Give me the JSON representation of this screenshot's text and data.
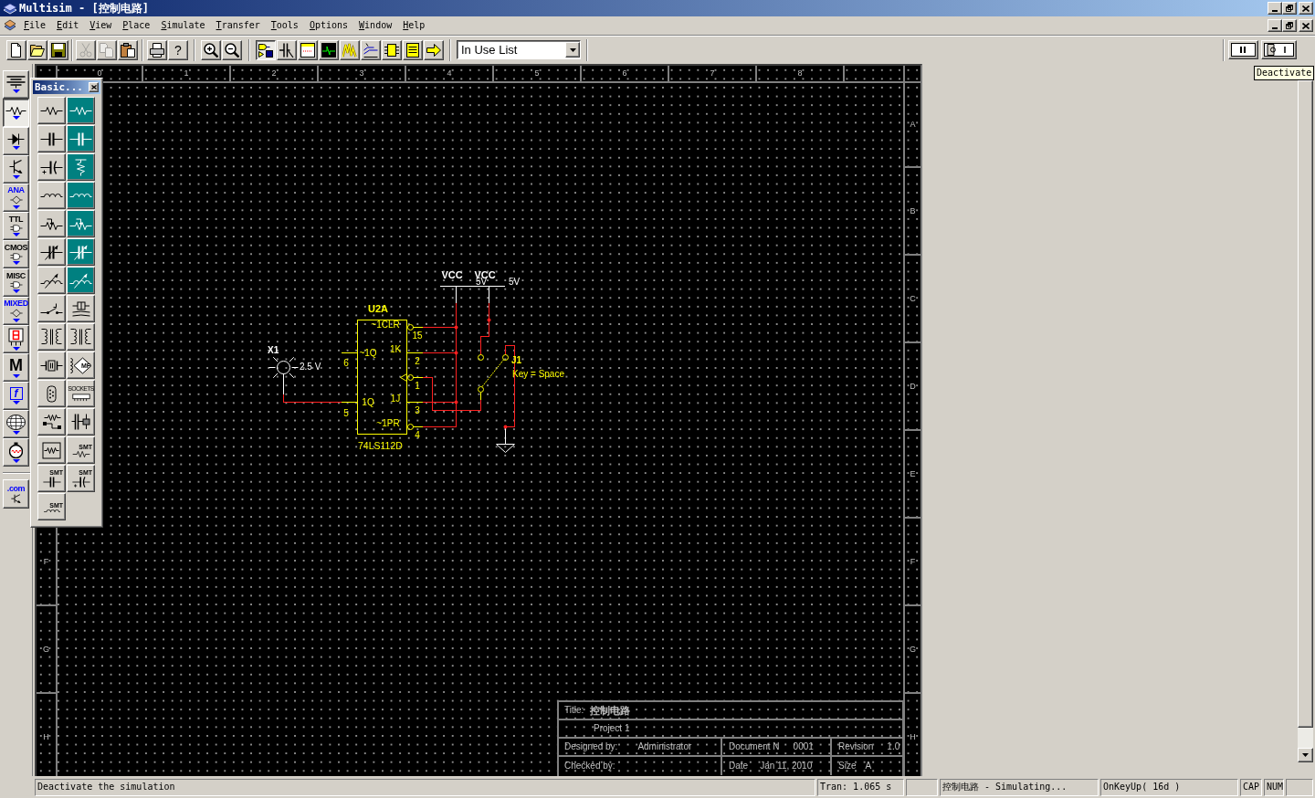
{
  "window": {
    "title": "Multisim - [控制电路]"
  },
  "menu": [
    "File",
    "Edit",
    "View",
    "Place",
    "Simulate",
    "Transfer",
    "Tools",
    "Options",
    "Window",
    "Help"
  ],
  "toolbar": {
    "buttons": [
      {
        "disabled": false,
        "pressed": false
      },
      {
        "disabled": false,
        "pressed": false
      },
      {
        "disabled": false,
        "pressed": false
      },
      {
        "disabled": true,
        "pressed": false
      },
      {
        "disabled": true,
        "pressed": false
      },
      {
        "disabled": false,
        "pressed": false
      },
      {
        "disabled": false,
        "pressed": false
      },
      {
        "label": "?",
        "disabled": false,
        "pressed": false
      },
      {
        "disabled": false,
        "pressed": false
      },
      {
        "disabled": false,
        "pressed": false
      },
      {
        "disabled": false,
        "pressed": true
      },
      {
        "disabled": false,
        "pressed": false
      },
      {
        "disabled": false,
        "pressed": false
      },
      {
        "disabled": false,
        "pressed": false
      },
      {
        "disabled": false,
        "pressed": false
      },
      {
        "disabled": false,
        "pressed": false
      },
      {
        "disabled": false,
        "pressed": false
      },
      {
        "disabled": false,
        "pressed": false
      },
      {
        "disabled": false,
        "pressed": false
      }
    ],
    "list": {
      "value": "In Use List"
    }
  },
  "simulation": {
    "running": true,
    "paused": false
  },
  "tooltip": {
    "text": "Deactivate"
  },
  "component_bins": [
    {
      "selected": false
    },
    {
      "selected": true
    },
    {
      "selected": false
    },
    {
      "selected": false
    },
    {
      "label": "ANA",
      "color": "#0000ff",
      "selected": false
    },
    {
      "label": "TTL",
      "color": "#000000",
      "selected": false
    },
    {
      "label": "CMOS",
      "color": "#000000",
      "selected": false
    },
    {
      "label": "MISC",
      "color": "#000000",
      "selected": false
    },
    {
      "label": "MIXED",
      "color": "#0000ff",
      "selected": false
    },
    {
      "selected": false
    },
    {
      "label": "M",
      "color": "#000000",
      "selected": false
    },
    {
      "label": "f",
      "color": "#0000ff",
      "selected": false
    },
    {
      "selected": false
    },
    {
      "selected": false
    },
    {
      "label": ".com",
      "color": "#0000ff",
      "selected": false
    }
  ],
  "basic_palette": {
    "title": "Basic...",
    "parts": [
      {
        "color": "#d4d0c8"
      },
      {
        "color": "#008080"
      },
      {
        "color": "#d4d0c8"
      },
      {
        "color": "#008080"
      },
      {
        "color": "#d4d0c8"
      },
      {
        "color": "#008080"
      },
      {
        "color": "#d4d0c8"
      },
      {
        "color": "#008080"
      },
      {
        "color": "#d4d0c8"
      },
      {
        "color": "#008080"
      },
      {
        "color": "#d4d0c8"
      },
      {
        "color": "#008080"
      },
      {
        "color": "#d4d0c8"
      },
      {
        "color": "#008080"
      },
      {
        "color": "#d4d0c8"
      },
      {
        "color": "#d4d0c8"
      },
      {
        "color": "#d4d0c8"
      },
      {
        "color": "#d4d0c8"
      },
      {
        "color": "#d4d0c8"
      },
      {
        "color": "#d4d0c8",
        "label": "MF"
      },
      {
        "color": "#d4d0c8"
      },
      {
        "color": "#d4d0c8",
        "label": "SOCKETS"
      },
      {
        "color": "#d4d0c8"
      },
      {
        "color": "#d4d0c8"
      },
      {
        "color": "#d4d0c8"
      },
      {
        "color": "#d4d0c8",
        "label": "SMT"
      },
      {
        "color": "#d4d0c8",
        "label": "SMT"
      },
      {
        "color": "#d4d0c8",
        "label": "SMT"
      },
      {
        "color": "#d4d0c8",
        "label": "SMT"
      }
    ]
  },
  "schematic": {
    "column_labels": [
      "0",
      "1",
      "2",
      "3",
      "4",
      "5",
      "6",
      "7",
      "8"
    ],
    "row_labels_left": [
      "F",
      "G",
      "H"
    ],
    "row_labels_right": [
      "A",
      "B",
      "C",
      "D",
      "E",
      "F",
      "G",
      "H"
    ],
    "circuit": {
      "supplies": [
        {
          "label": "VCC",
          "voltage": "5V"
        },
        {
          "label": "VCC",
          "voltage": "5V"
        }
      ],
      "flip_flop": {
        "reference": "U2A",
        "part": "74LS112D",
        "right_pins": [
          {
            "name": "~1CLR",
            "number": "15",
            "inverted": true,
            "clock": false
          },
          {
            "name": "1K",
            "number": "2",
            "inverted": false,
            "clock": false
          },
          {
            "number": "1",
            "inverted": true,
            "clock": true
          },
          {
            "name": "1J",
            "number": "3",
            "inverted": false,
            "clock": false
          },
          {
            "name": "~1PR",
            "number": "4",
            "inverted": true,
            "clock": false
          }
        ],
        "left_pins": [
          {
            "name": "~1Q",
            "number": "6"
          },
          {
            "name": "1Q",
            "number": "5"
          }
        ]
      },
      "lamp": {
        "reference": "X1",
        "rating": "2.5 V"
      },
      "switch": {
        "reference": "J1",
        "key": "Key = Space",
        "on": true
      }
    },
    "title_block": {
      "title_label": "Title:",
      "title": "控制电路",
      "project": "Project 1",
      "designed_by_label": "Designed by:",
      "designed_by": "Administrator",
      "document_label": "Document N",
      "document": "0001",
      "revision_label": "Revision",
      "revision": "1.0",
      "checked_by_label": "Checked by:",
      "date_label": "Date",
      "date": "Jan 11, 2010",
      "size_label": "Size",
      "size": "A"
    }
  },
  "status_bar": [
    "Deactivate the simulation",
    "Tran: 1.065 s",
    "控制电路 - Simulating...",
    "OnKeyUp( 16d )",
    "CAP",
    "NUM"
  ]
}
